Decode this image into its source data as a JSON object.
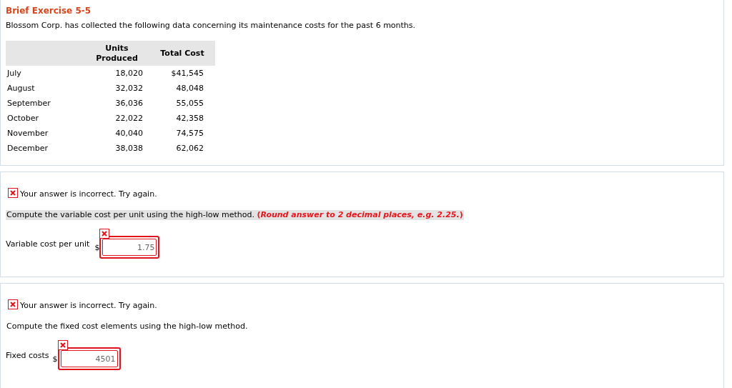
{
  "exercise": {
    "title": "Brief Exercise 5-5",
    "intro": "Blossom Corp. has collected the following data concerning its maintenance costs for the past 6 months.",
    "table": {
      "columns": [
        "",
        "Units Produced",
        "Total Cost"
      ],
      "rows": [
        [
          "July",
          "18,020",
          "$41,545"
        ],
        [
          "August",
          "32,032",
          "48,048"
        ],
        [
          "September",
          "36,036",
          "55,055"
        ],
        [
          "October",
          "22,022",
          "42,358"
        ],
        [
          "November",
          "40,040",
          "74,575"
        ],
        [
          "December",
          "38,038",
          "62,062"
        ]
      ]
    }
  },
  "questions": [
    {
      "feedback": "Your answer is incorrect.  Try again.",
      "correct": false,
      "prompt": "Compute the variable cost per unit using the high-low method. **(*Round answer to 2 decimal places, e.g. 2.25.*)**",
      "prompt_highlighted": true,
      "label": "Variable cost per unit",
      "currency": "$",
      "value": "1.75",
      "field_correct": false
    },
    {
      "feedback": "Your answer is incorrect.  Try again.",
      "correct": false,
      "prompt": "Compute the fixed cost elements using the high-low method.",
      "prompt_highlighted": false,
      "label": "Fixed costs",
      "currency": "$",
      "value": "4501",
      "field_correct": false
    }
  ]
}
